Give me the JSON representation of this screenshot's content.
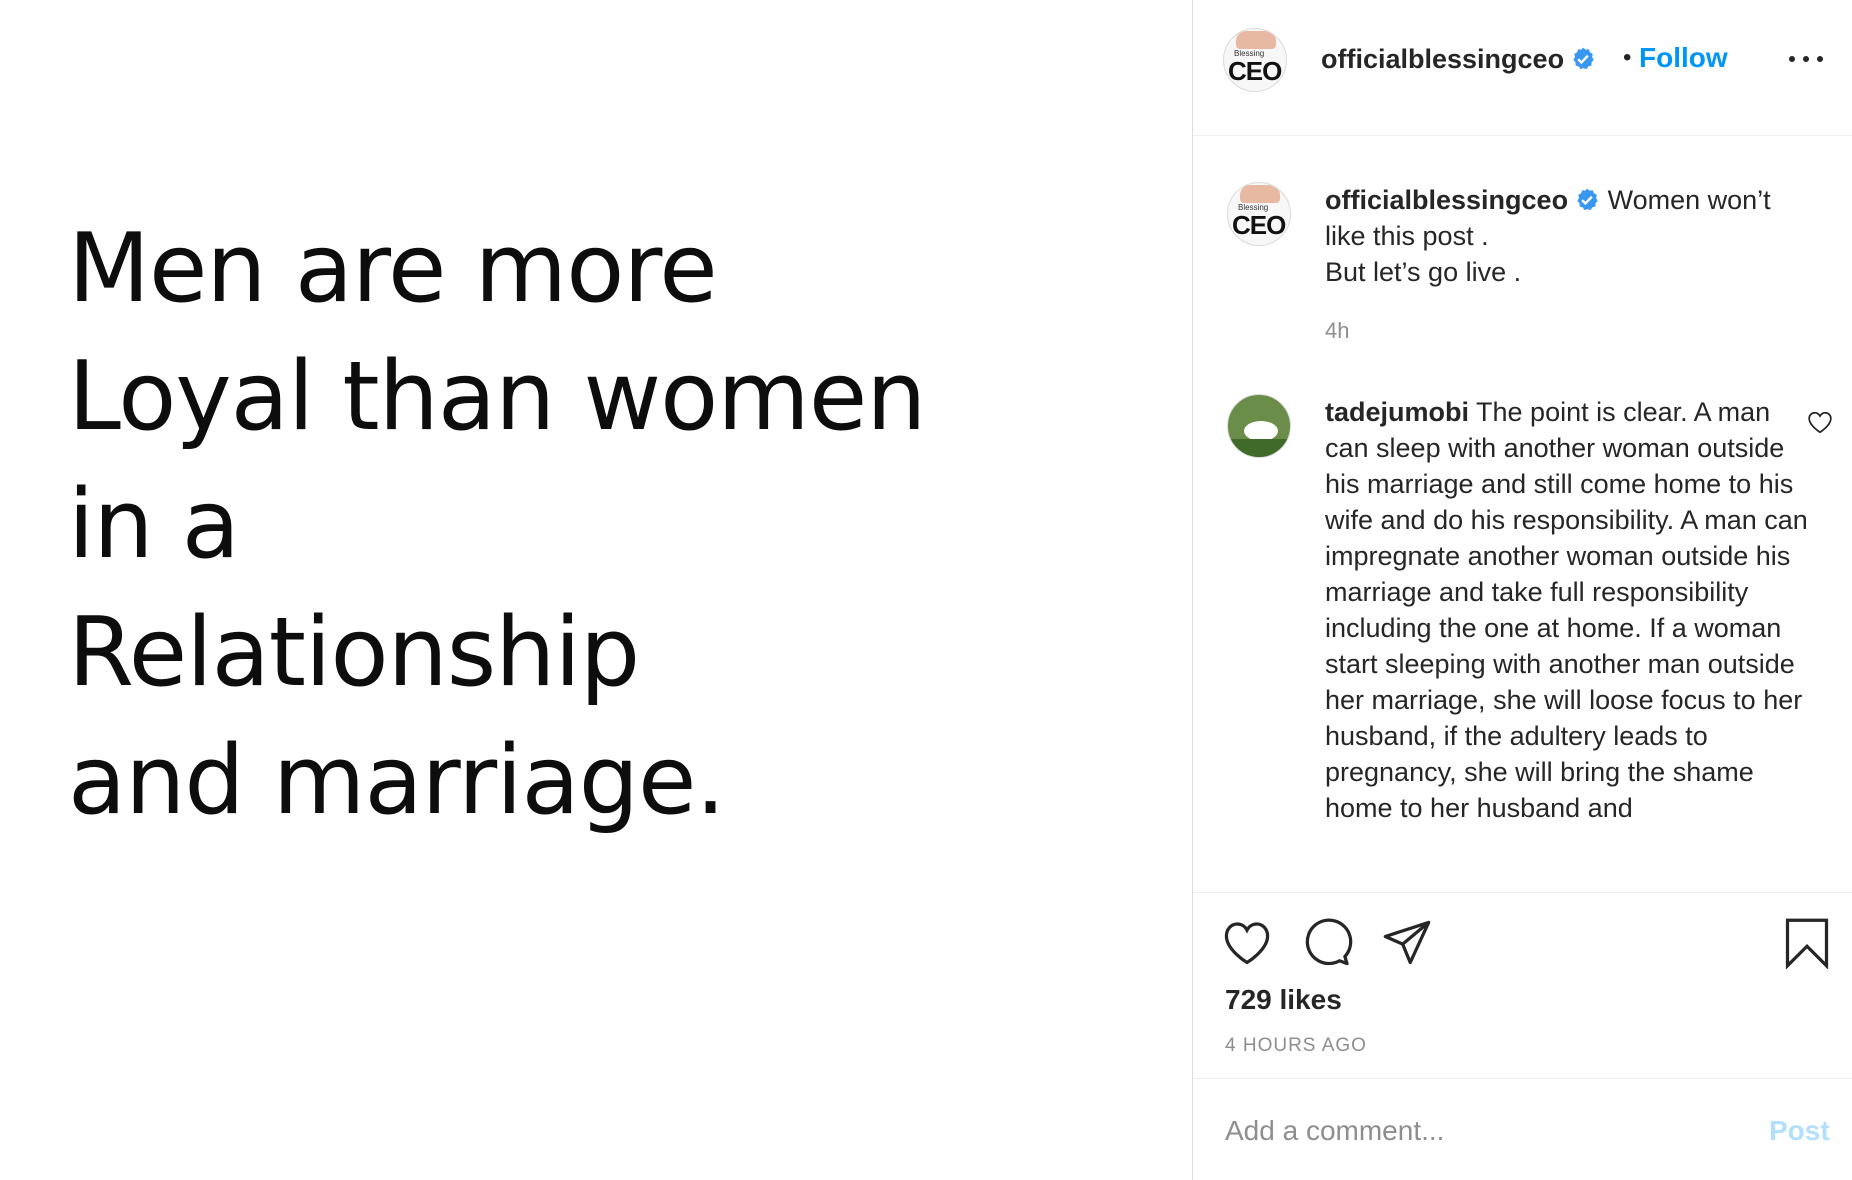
{
  "media": {
    "quote_lines": [
      "Men are more",
      "Loyal than women",
      "in a",
      "Relationship",
      "and marriage."
    ]
  },
  "header": {
    "username": "officialblessingceo",
    "separator": "•",
    "follow_label": "Follow",
    "avatar_small_text": "Blessing",
    "avatar_text": "CEO"
  },
  "caption": {
    "username": "officialblessingceo",
    "text_line1": "Women won’t like this post .",
    "text_line2": "But let’s go live .",
    "time": "4h"
  },
  "comment": {
    "username": "tadejumobi",
    "text": "The point is clear. A man can sleep with another woman outside his marriage and still come home to his wife and do his responsibility. A man can impregnate another woman outside his marriage and take full responsibility including the one at home. If a woman start sleeping with another man outside her marriage, she will loose focus to her husband, if the adultery leads to pregnancy, she will bring the shame home to her husband and"
  },
  "actions": {
    "likes": "729 likes",
    "time_ago": "4 HOURS AGO"
  },
  "add_comment": {
    "placeholder": "Add a comment...",
    "post_label": "Post"
  },
  "colors": {
    "link_blue": "#0095f6",
    "post_disabled": "#b2dffc",
    "verified_blue": "#3897f0",
    "muted": "#8e8e8e"
  },
  "icons": [
    "verified-badge-icon",
    "more-options-icon",
    "like-heart-icon",
    "comment-icon",
    "share-icon",
    "save-bookmark-icon",
    "comment-like-icon"
  ]
}
